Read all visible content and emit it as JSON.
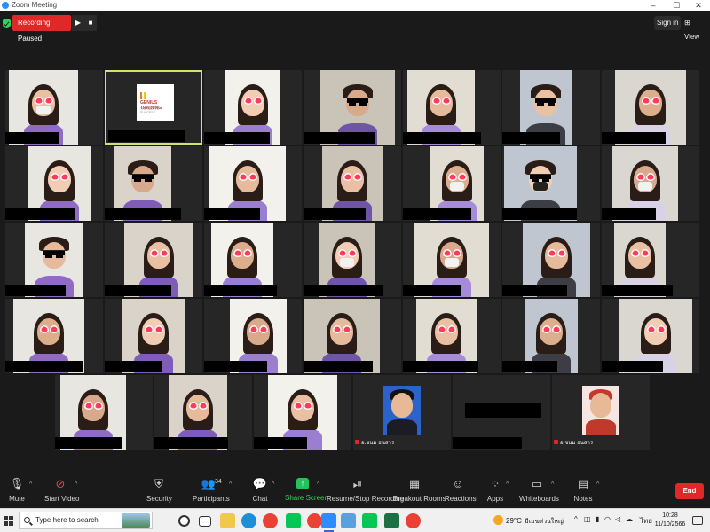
{
  "window": {
    "title": "Zoom Meeting",
    "controls": {
      "minimize": "–",
      "maximize": "☐",
      "close": "✕"
    }
  },
  "topbar": {
    "recording_status": "Recording Paused",
    "resume_icon": "▶",
    "stop_icon": "■",
    "sign_in": "Sign in",
    "view": "View",
    "view_icon": "grid-icon"
  },
  "gallery": {
    "participants": [
      {
        "filter": "hearts",
        "mask": true
      },
      {
        "type": "logo",
        "logo_line1": "GENIUS TRAINING",
        "logo_line2": "THE WAY TO SUCCESS",
        "active_speaker": true
      },
      {
        "filter": "hearts"
      },
      {
        "filter": "sunglasses"
      },
      {
        "filter": "hearts"
      },
      {
        "filter": "sunglasses"
      },
      {
        "filter": "hearts"
      },
      {
        "filter": "hearts"
      },
      {
        "filter": "sunglasses"
      },
      {
        "filter": "hearts"
      },
      {
        "filter": "hearts"
      },
      {
        "filter": "hearts",
        "mask": true
      },
      {
        "filter": "sunglasses",
        "mask": true
      },
      {
        "filter": "hearts",
        "mask": true
      },
      {
        "filter": "sunglasses"
      },
      {
        "filter": "hearts"
      },
      {
        "filter": "hearts"
      },
      {
        "filter": "hearts",
        "mask": true
      },
      {
        "filter": "hearts",
        "mask": true
      },
      {
        "filter": "hearts"
      },
      {
        "filter": "hearts"
      },
      {
        "filter": "hearts"
      },
      {
        "filter": "hearts"
      },
      {
        "filter": "hearts"
      },
      {
        "filter": "hearts"
      },
      {
        "filter": "hearts"
      },
      {
        "filter": "hearts"
      },
      {
        "filter": "hearts"
      },
      {
        "filter": "hearts"
      },
      {
        "filter": "hearts"
      },
      {
        "filter": "hearts"
      },
      {
        "type": "photo",
        "name": "อ.ชนม ธนสาร"
      },
      {
        "type": "blank"
      },
      {
        "type": "photo",
        "name": "อ.ชนม ธนสาร"
      }
    ]
  },
  "toolbar": {
    "mute": "Mute",
    "start_video": "Start Video",
    "security": "Security",
    "participants": "Participants",
    "participants_count": "34",
    "chat": "Chat",
    "share_screen": "Share Screen",
    "resume_stop_recording": "Resume/Stop Recording",
    "breakout_rooms": "Breakout Rooms",
    "reactions": "Reactions",
    "apps": "Apps",
    "whiteboards": "Whiteboards",
    "notes": "Notes",
    "end": "End",
    "caret": "^"
  },
  "taskbar": {
    "search_placeholder": "Type here to search",
    "apps": [
      "cortana-icon",
      "task-view-icon",
      "file-explorer-icon",
      "edge-icon",
      "chrome-icon",
      "line-icon",
      "chrome-icon",
      "zoom-icon",
      "files-icon",
      "line-icon",
      "excel-icon",
      "chrome-icon"
    ],
    "temperature": "29°C",
    "weather_text": "มีเมฆส่วนใหญ่",
    "tray_up": "^",
    "language": "ไทย",
    "time": "10:28",
    "date": "11/10/2566"
  },
  "colors": {
    "background": "#1a1a1a",
    "recording": "#e02828",
    "share_screen": "#23d959",
    "active_speaker": "#cfe26a",
    "end_button": "#e02828"
  }
}
